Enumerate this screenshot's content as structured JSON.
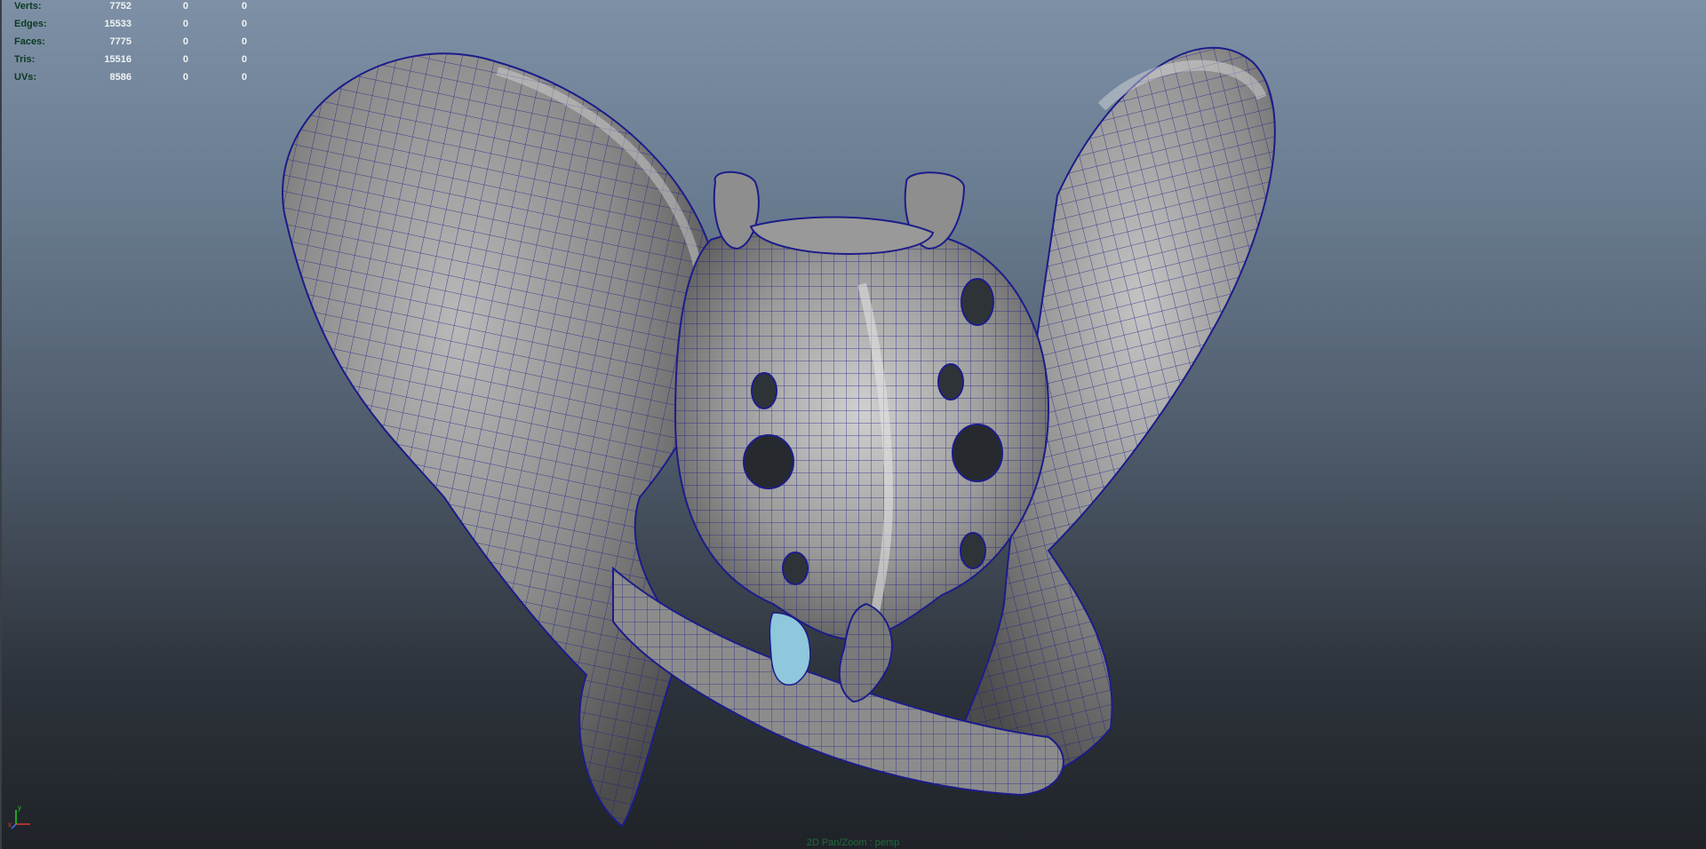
{
  "hud": {
    "rows": [
      {
        "label": "Verts:",
        "values": [
          "7752",
          "0",
          "0"
        ]
      },
      {
        "label": "Edges:",
        "values": [
          "15533",
          "0",
          "0"
        ]
      },
      {
        "label": "Faces:",
        "values": [
          "7775",
          "0",
          "0"
        ]
      },
      {
        "label": "Tris:",
        "values": [
          "15516",
          "0",
          "0"
        ]
      },
      {
        "label": "UVs:",
        "values": [
          "8586",
          "0",
          "0"
        ]
      }
    ]
  },
  "axis": {
    "x_label": "x",
    "y_label": "y"
  },
  "camera": {
    "label": "2D Pan/Zoom : persp"
  },
  "colors": {
    "hud_label": "#0b3a22",
    "hud_value": "#f0f3f5",
    "wireframe": "#1c1c8a",
    "mesh_fill": "#8a8a8a",
    "selected_part": "#8fc7dc",
    "camera_label": "#1f6b3a"
  },
  "icons": {
    "axis": "axis-gizmo-icon"
  }
}
